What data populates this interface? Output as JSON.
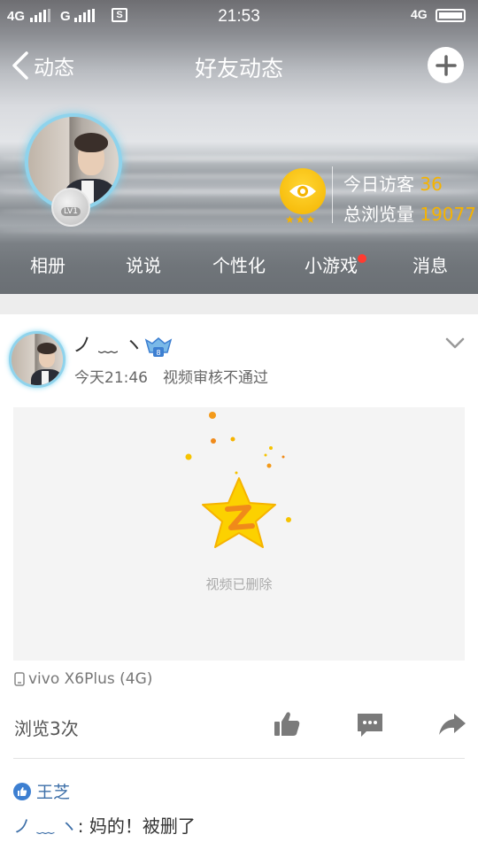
{
  "status_bar": {
    "sim1": "4G",
    "sim2": "G",
    "sd_icon": "S",
    "time": "21:53",
    "network": "4G"
  },
  "nav": {
    "back_label": "动态",
    "title": "好友动态",
    "back_icon": "chevron-left-icon",
    "add_icon": "plus-icon"
  },
  "profile": {
    "level_label": "LV1",
    "visitors_today_label": "今日访客",
    "visitors_today": "36",
    "total_views_label": "总浏览量",
    "total_views": "19077",
    "badge_icon": "eye-icon",
    "badge_stars": "★★★",
    "accent_color": "#f6b300"
  },
  "tabs": [
    {
      "label": "相册"
    },
    {
      "label": "说说"
    },
    {
      "label": "个性化"
    },
    {
      "label": "小游戏",
      "has_notification_dot": true
    },
    {
      "label": "消息"
    }
  ],
  "post": {
    "author": "ノ ﹏ ヽ",
    "time": "今天21:46",
    "status": "视频审核不通过",
    "video_placeholder": "视频已删除",
    "device": "vivo X6Plus (4G)",
    "views": "浏览3次",
    "actions": [
      "like-icon",
      "comment-icon",
      "share-icon"
    ],
    "liked_by": "王芝",
    "comment": {
      "author": "ノ ﹏ ヽ",
      "text": ": 妈的！被删了"
    }
  }
}
